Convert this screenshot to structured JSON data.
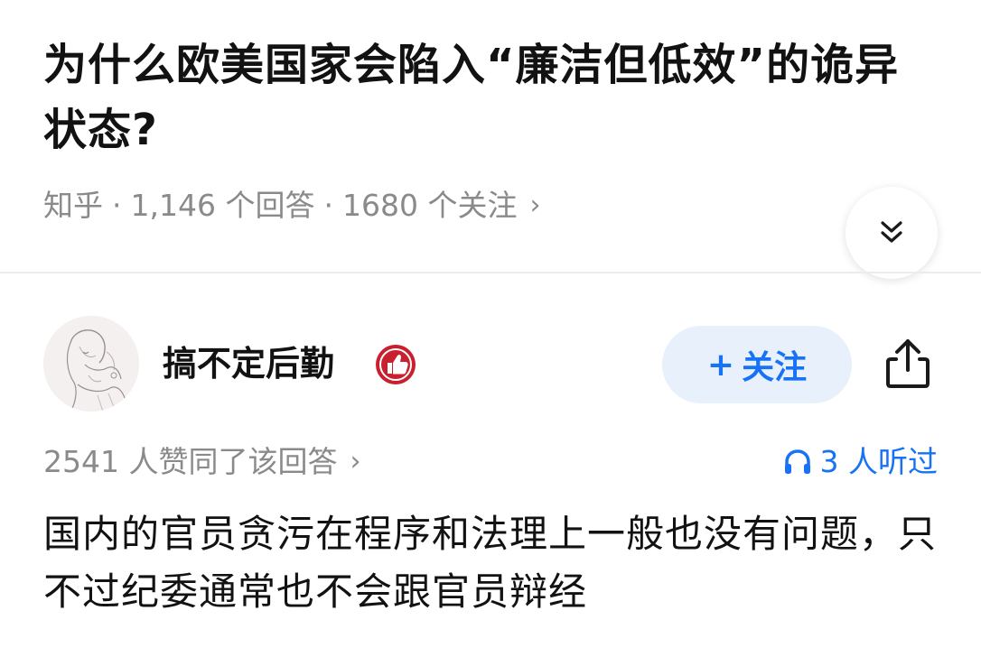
{
  "question": {
    "title": "为什么欧美国家会陷入“廉洁但低效”的诡异状态?",
    "source": "知乎",
    "answers_count": "1,146 个回答",
    "followers_count": "1680 个关注",
    "separator": "·",
    "chevron": "›"
  },
  "answer": {
    "author_name": "搞不定后勤",
    "follow_plus": "+",
    "follow_label": "关注",
    "upvote_text": "2541 人赞同了该回答",
    "upvote_chevron": "›",
    "listen_text": "3 人听过",
    "excerpt": "国内的官员贪污在程序和法理上一般也没有问题，只不过纪委通常也不会跟官员辩经"
  },
  "icons": {
    "collapse": "double-chevron-down-icon",
    "badge": "thumbs-up-badge-icon",
    "share": "share-icon",
    "listen": "headphones-icon"
  },
  "colors": {
    "accent": "#1772f6",
    "follow_bg": "#e8f0fc",
    "muted_text": "#8a8a8a",
    "badge_red": "#c8202f"
  }
}
